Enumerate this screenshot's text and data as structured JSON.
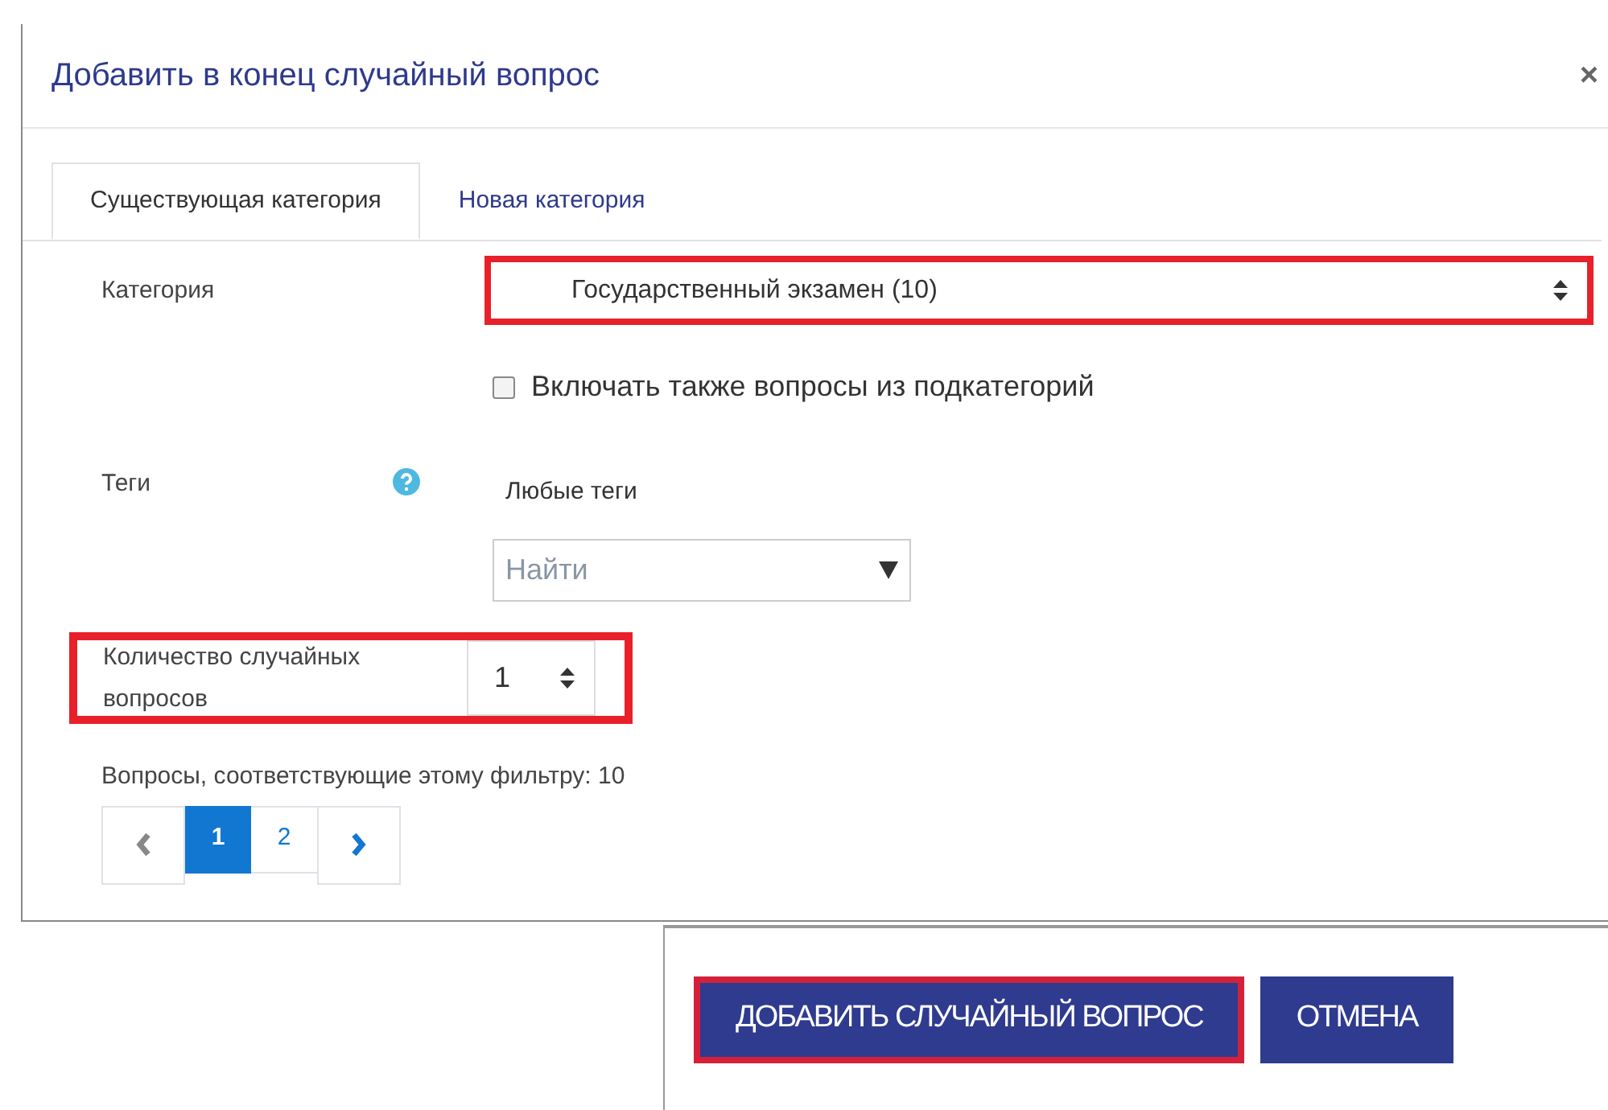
{
  "dialog": {
    "title": "Добавить в конец случайный вопрос",
    "close": "×"
  },
  "tabs": [
    {
      "label": "Существующая категория",
      "selected": true
    },
    {
      "label": "Новая категория",
      "selected": false
    }
  ],
  "category": {
    "label": "Категория",
    "value": "Государственный экзамен (10)",
    "highlighted": true
  },
  "include_subcategories": {
    "label": "Включать также вопросы из подкатегорий",
    "checked": false
  },
  "tags": {
    "label": "Теги",
    "value": "Любые теги",
    "search_placeholder": "Найти"
  },
  "count": {
    "label": "Количество случайных вопросов",
    "value": "1",
    "highlighted": true
  },
  "matching": "Вопросы, соответствующие этому фильтру: 10",
  "pages": [
    {
      "label": "1",
      "selected": true
    },
    {
      "label": "2",
      "selected": false
    }
  ],
  "buttons": [
    {
      "label": "ДОБАВИТЬ СЛУЧАЙНЫЙ ВОПРОС",
      "highlighted": true
    },
    {
      "label": "ОТМЕНА",
      "highlighted": false
    }
  ]
}
